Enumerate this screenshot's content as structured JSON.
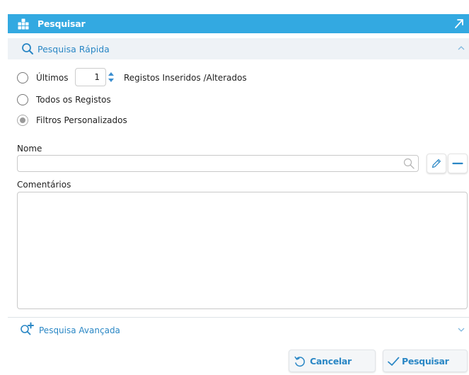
{
  "header": {
    "title": "Pesquisar",
    "icon": "cube-icon",
    "expand_icon": "expand-arrow-icon",
    "bg": "#33a9e1"
  },
  "quick_search": {
    "label": "Pesquisa Rápida",
    "icon": "search-icon",
    "accent": "#2a87c5"
  },
  "options": {
    "last": {
      "label": "Últimos",
      "count": "1",
      "suffix": "Registos Inseridos /Alterados"
    },
    "all": {
      "label": "Todos os Registos"
    },
    "custom": {
      "label": "Filtros Personalizados",
      "selected": true
    }
  },
  "form": {
    "name_label": "Nome",
    "name_value": "",
    "comments_label": "Comentários",
    "comments_value": ""
  },
  "advanced_search": {
    "label": "Pesquisa Avançada",
    "icon": "search-plus-icon"
  },
  "buttons": {
    "cancel": "Cancelar",
    "search": "Pesquisar"
  }
}
